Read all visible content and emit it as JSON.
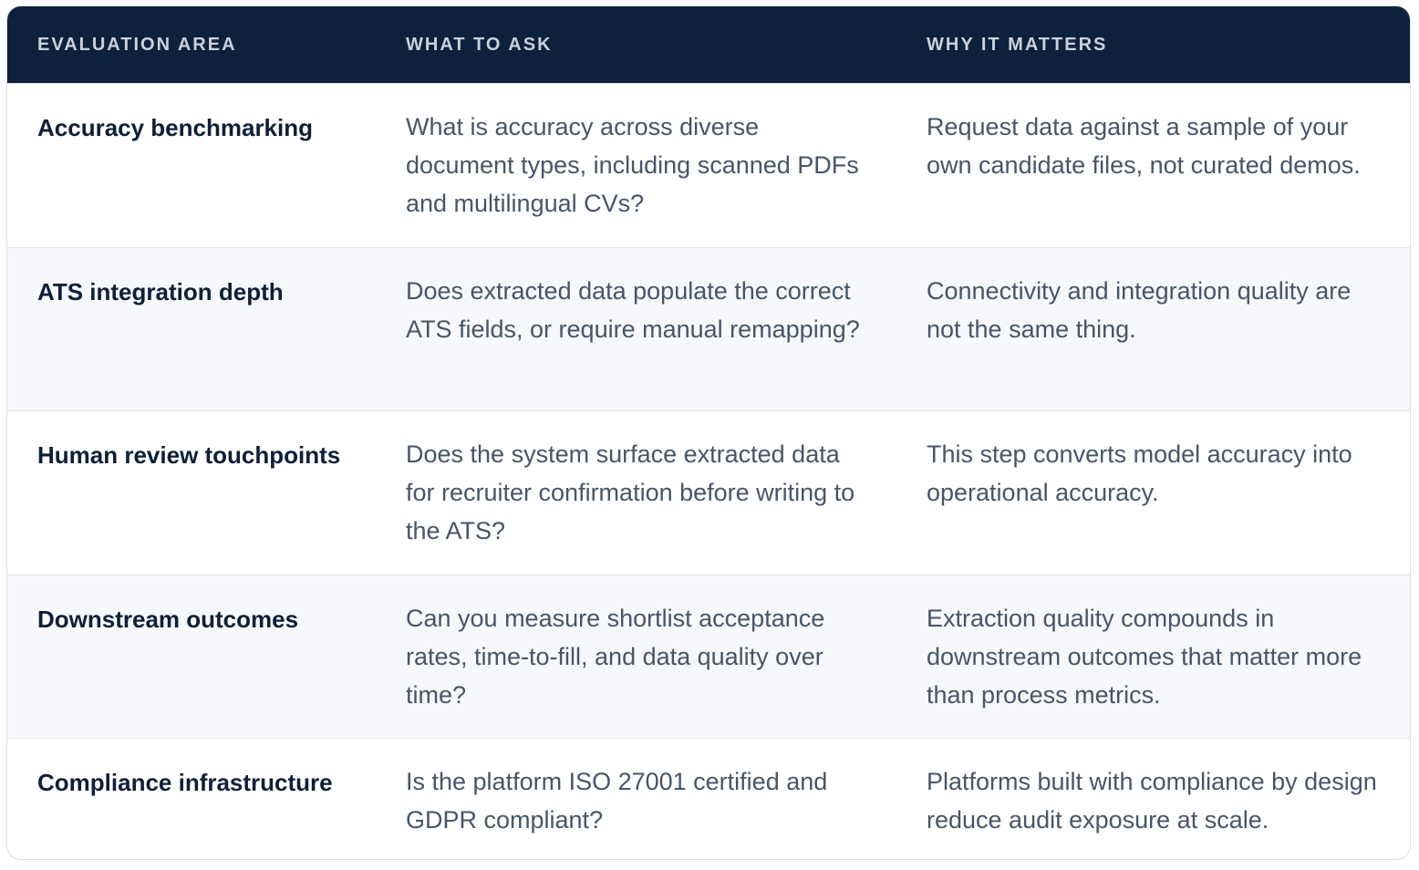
{
  "table": {
    "headers": {
      "area": "EVALUATION AREA",
      "ask": "WHAT TO ASK",
      "why": "WHY IT MATTERS"
    },
    "rows": [
      {
        "area": "Accuracy benchmarking",
        "ask": "What is accuracy across diverse document types, including scanned PDFs and multilingual CVs?",
        "why": "Request data against a sample of your own candidate files, not curated demos."
      },
      {
        "area": "ATS integration depth",
        "ask": "Does extracted data populate the correct ATS fields, or require manual remapping?",
        "why": "Connectivity and integration quality are not the same thing."
      },
      {
        "area": "Human review touchpoints",
        "ask": "Does the system surface extracted data for recruiter confirmation before writing to the ATS?",
        "why": "This step converts model accuracy into operational accuracy."
      },
      {
        "area": "Downstream outcomes",
        "ask": "Can you measure shortlist acceptance rates, time-to-fill, and data quality over time?",
        "why": "Extraction quality compounds in downstream outcomes that matter more than process metrics."
      },
      {
        "area": "Compliance infrastructure",
        "ask": "Is the platform ISO 27001 certified and GDPR compliant?",
        "why": "Platforms built with compliance by design reduce audit exposure at scale."
      }
    ]
  },
  "colors": {
    "header_bg": "#0d213c",
    "header_text": "#c9d1dc",
    "row_alt_bg": "#f6f8fb",
    "area_text": "#0e1f38",
    "body_text": "#475569"
  }
}
